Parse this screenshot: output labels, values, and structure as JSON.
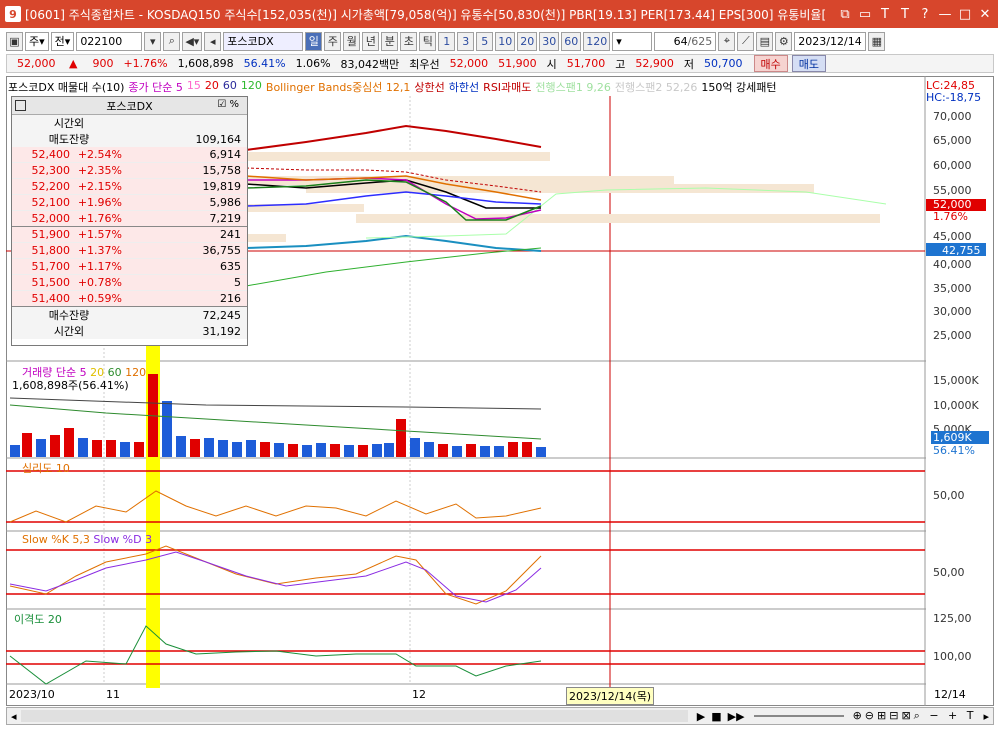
{
  "window": {
    "number": "9",
    "title": "[0601] 주식종합차트 - KOSDAQ150 주식수[152,035(천)] 시가총액[79,058(억)] 유통수[50,830(천)] PBR[19.13] PER[173.44] EPS[300] 유통비율[",
    "controls": [
      "⧉",
      "▭",
      "T",
      "T",
      "?",
      "—",
      "□",
      "✕"
    ]
  },
  "toolbar": {
    "period_type": "주",
    "market": "전",
    "code": "022100",
    "stock_name": "포스코DX",
    "timeframes": [
      "일",
      "주",
      "월",
      "년",
      "분",
      "초",
      "틱"
    ],
    "active_timeframe": "일",
    "intervals": [
      "1",
      "3",
      "5",
      "10",
      "20",
      "30",
      "60",
      "120"
    ],
    "count": "64",
    "total": "/625",
    "date": "2023/12/14"
  },
  "price": {
    "current": "52,000",
    "arrow": "▲",
    "change": "900",
    "change_pct": "+1.76%",
    "volume": "1,608,898",
    "vol_pct": "56.41%",
    "turnover": "1.06%",
    "amount": "83,042백만",
    "best_ask_label": "최우선",
    "best_ask": "52,000",
    "best_bid": "51,900",
    "open_label": "시",
    "open": "51,700",
    "high_label": "고",
    "high": "52,900",
    "low_label": "저",
    "low": "50,700",
    "buy_label": "매수",
    "sell_label": "매도"
  },
  "legend": {
    "name": "포스코DX 매물대 수(10)",
    "ma": "종가 단순 5",
    "ma_periods": [
      "15",
      "20",
      "60",
      "120"
    ],
    "bollinger": "Bollinger Bands중심선 12,1",
    "upper": "상한선",
    "lower": "하한선",
    "rsi": "RSI과매도",
    "ichimoku1": "전행스팬1 9,26",
    "ichimoku2": "전행스팬2 52,26",
    "strength": "150억 강세패턴",
    "lc": "LC:24,85",
    "hc": "HC:-18,75"
  },
  "price_axis": [
    "70,000",
    "65,000",
    "60,000",
    "55,000",
    "50,000",
    "45,000",
    "40,000",
    "35,000",
    "30,000",
    "25,000"
  ],
  "price_tags": {
    "current": "52,000",
    "pct": "1.76%",
    "line": "42,755"
  },
  "orderbook": {
    "title": "포스코DX",
    "check_label": "%",
    "after_hours_label": "시간외",
    "ask_remain_label": "매도잔량",
    "ask_total": "109,164",
    "asks": [
      {
        "price": "52,400",
        "pct": "+2.54%",
        "vol": "6,914"
      },
      {
        "price": "52,300",
        "pct": "+2.35%",
        "vol": "15,758"
      },
      {
        "price": "52,200",
        "pct": "+2.15%",
        "vol": "19,819"
      },
      {
        "price": "52,100",
        "pct": "+1.96%",
        "vol": "5,986"
      },
      {
        "price": "52,000",
        "pct": "+1.76%",
        "vol": "7,219"
      }
    ],
    "bids": [
      {
        "price": "51,900",
        "pct": "+1.57%",
        "vol": "241"
      },
      {
        "price": "51,800",
        "pct": "+1.37%",
        "vol": "36,755"
      },
      {
        "price": "51,700",
        "pct": "+1.17%",
        "vol": "635"
      },
      {
        "price": "51,500",
        "pct": "+0.78%",
        "vol": "5"
      },
      {
        "price": "51,400",
        "pct": "+0.59%",
        "vol": "216"
      }
    ],
    "bid_remain_label": "매수잔량",
    "bid_total": "72,245",
    "after_hours_total": "31,192"
  },
  "volume_panel": {
    "label": "거래량 단순 5",
    "periods": [
      "20",
      "60",
      "120"
    ],
    "value": "1,608,898주(56.41%)",
    "axis": [
      "15,000K",
      "10,000K",
      "5,000K"
    ],
    "tag": "1,609K",
    "tag_pct": "56.41%"
  },
  "psych_panel": {
    "label": "심리도 10",
    "axis": "50,00"
  },
  "stoch_panel": {
    "label_k": "Slow %K 5,3",
    "label_d": "Slow %D 3",
    "axis": "50,00"
  },
  "disp_panel": {
    "label": "이격도 20",
    "axis": [
      "125,00",
      "100,00"
    ]
  },
  "xaxis": {
    "labels": [
      "2023/10",
      "11",
      "12"
    ],
    "cursor_date": "2023/12/14(목)",
    "end": "12/14"
  },
  "colors": {
    "title_bg": "#d7462c",
    "up": "#e00000",
    "down": "#0030c0"
  }
}
